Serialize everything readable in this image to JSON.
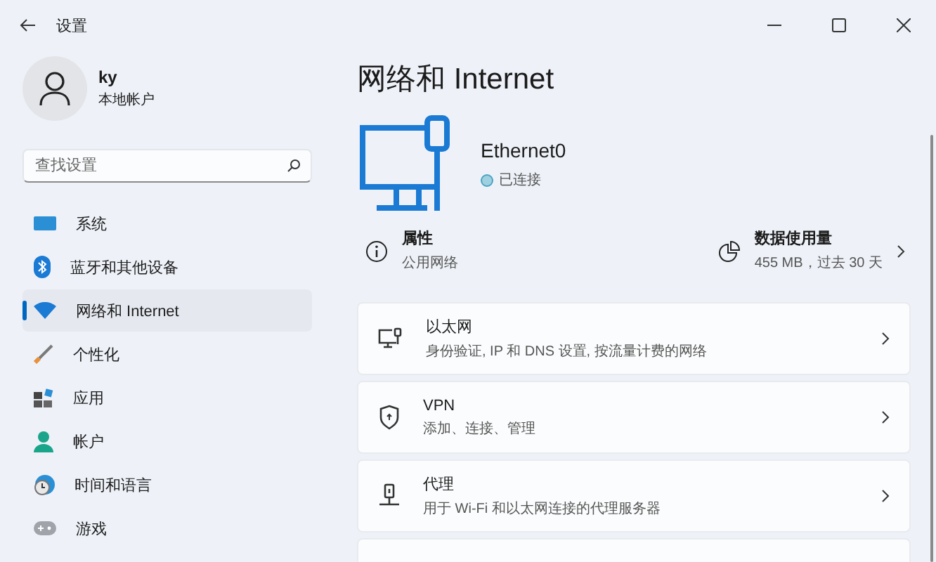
{
  "window": {
    "title": "设置"
  },
  "user": {
    "name": "ky",
    "account": "本地帐户"
  },
  "search": {
    "placeholder": "查找设置"
  },
  "sidebar": {
    "items": [
      {
        "label": "系统",
        "selected": false
      },
      {
        "label": "蓝牙和其他设备",
        "selected": false
      },
      {
        "label": "网络和 Internet",
        "selected": true
      },
      {
        "label": "个性化",
        "selected": false
      },
      {
        "label": "应用",
        "selected": false
      },
      {
        "label": "帐户",
        "selected": false
      },
      {
        "label": "时间和语言",
        "selected": false
      },
      {
        "label": "游戏",
        "selected": false
      }
    ]
  },
  "page_title": "网络和 Internet",
  "connection": {
    "name": "Ethernet0",
    "status": "已连接"
  },
  "properties": {
    "title": "属性",
    "subtitle": "公用网络"
  },
  "data_usage": {
    "title": "数据使用量",
    "subtitle": "455 MB，过去 30 天"
  },
  "cards": [
    {
      "title": "以太网",
      "subtitle": "身份验证, IP 和 DNS 设置, 按流量计费的网络"
    },
    {
      "title": "VPN",
      "subtitle": "添加、连接、管理"
    },
    {
      "title": "代理",
      "subtitle": "用于 Wi-Fi 和以太网连接的代理服务器"
    }
  ]
}
